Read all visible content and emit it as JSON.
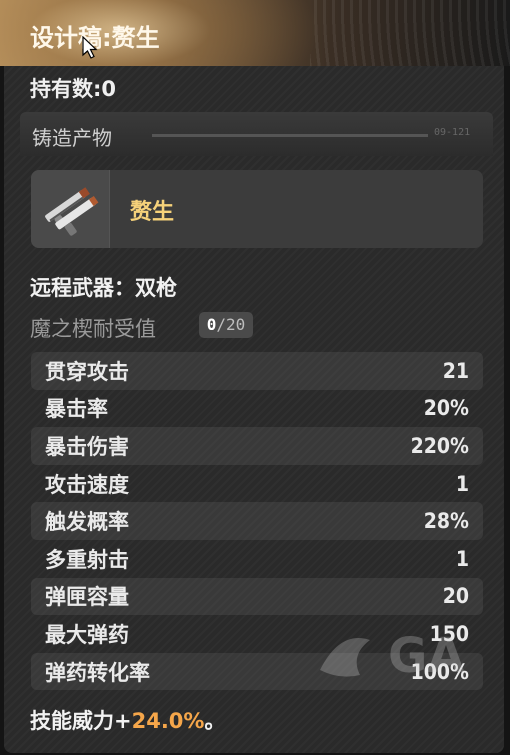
{
  "title": "设计稿:赘生",
  "owned_label": "持有数:0",
  "section": {
    "label": "铸造产物",
    "code": "09-121"
  },
  "item": {
    "name": "赘生",
    "icon": "dual-pistol-icon"
  },
  "weapon_type": "远程武器：双枪",
  "mastery": {
    "label": "魔之楔耐受值",
    "current": "0",
    "max": "/20"
  },
  "stats": [
    {
      "label": "贯穿攻击",
      "value": "21"
    },
    {
      "label": "暴击率",
      "value": "20%"
    },
    {
      "label": "暴击伤害",
      "value": "220%"
    },
    {
      "label": "攻击速度",
      "value": "1"
    },
    {
      "label": "触发概率",
      "value": "28%"
    },
    {
      "label": "多重射击",
      "value": "1"
    },
    {
      "label": "弹匣容量",
      "value": "20"
    },
    {
      "label": "最大弹药",
      "value": "150"
    },
    {
      "label": "弹药转化率",
      "value": "100%"
    }
  ],
  "skill": {
    "prefix": "技能威力+",
    "value": "24.0%",
    "suffix": "。"
  },
  "watermark": "GA",
  "colors": {
    "accent": "#f5a64a",
    "item_name": "#f6d27a"
  }
}
